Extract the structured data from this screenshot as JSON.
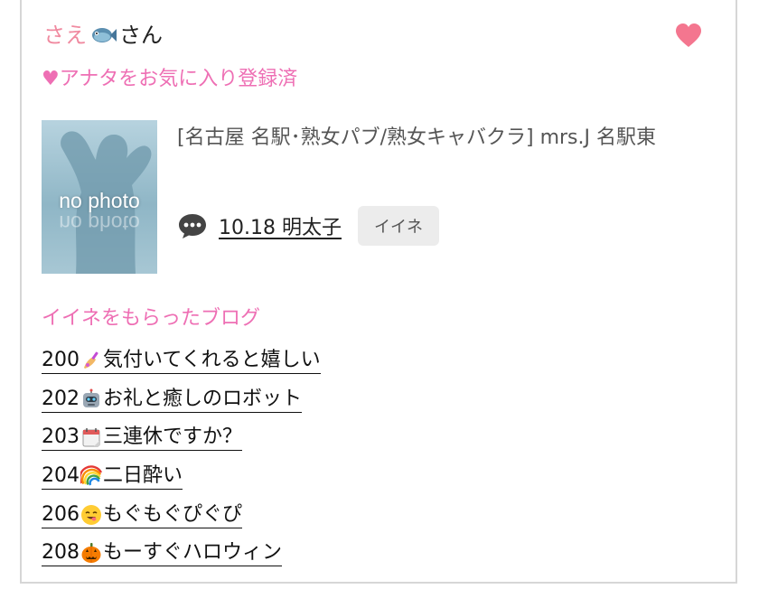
{
  "user": {
    "name": "さえ",
    "emoji": "fish-emoji",
    "suffix": "さん"
  },
  "favorite_status": "♥アナタをお気に入り登録済",
  "thumbnail": {
    "caption": "no photo"
  },
  "shop_info": "[名古屋 名駅･熟女パブ/熟女キャバクラ]  mrs.J 名駅東",
  "latest_post": {
    "label": "10.18 明太子",
    "like_button": "イイネ"
  },
  "liked_section": {
    "title": "イイネをもらったブログ",
    "items": [
      {
        "number": "200",
        "emoji": "nail-polish-emoji",
        "text": "気付いてくれると嬉しい"
      },
      {
        "number": "202",
        "emoji": "robot-emoji",
        "text": "お礼と癒しのロボット"
      },
      {
        "number": "203",
        "emoji": "calendar-emoji",
        "text": "三連休ですか？"
      },
      {
        "number": "204",
        "emoji": "rainbow-emoji",
        "text": "二日酔い"
      },
      {
        "number": "206",
        "emoji": "yum-face-emoji",
        "text": "もぐもぐぴぐぴ"
      },
      {
        "number": "208",
        "emoji": "pumpkin-emoji",
        "text": "もーすぐハロウィン"
      }
    ]
  },
  "colors": {
    "accent_pink": "#ee6fb4",
    "name_pink": "#f08aa0",
    "heart": "#f4768f"
  }
}
